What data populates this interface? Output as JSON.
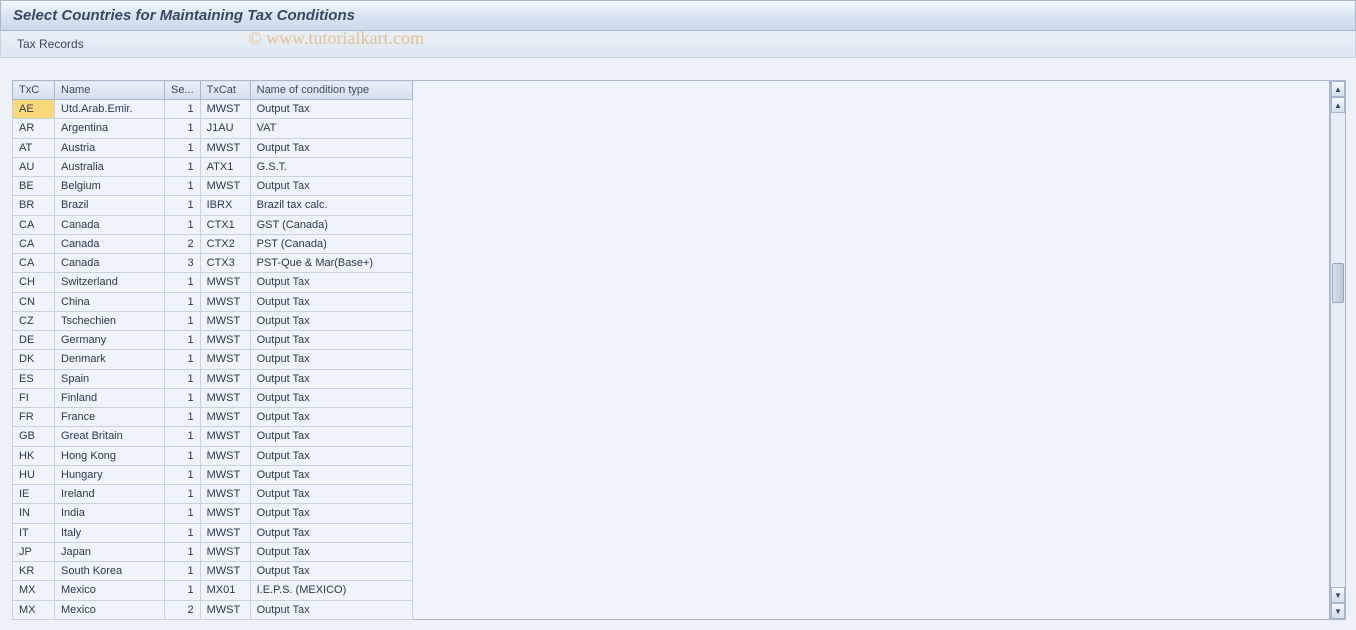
{
  "header": {
    "title": "Select Countries for Maintaining Tax Conditions",
    "subtitle": "Tax Records"
  },
  "watermark": "© www.tutorialkart.com",
  "table": {
    "columns": [
      {
        "key": "txc",
        "label": "TxC"
      },
      {
        "key": "name",
        "label": "Name"
      },
      {
        "key": "se",
        "label": "Se..."
      },
      {
        "key": "txcat",
        "label": "TxCat"
      },
      {
        "key": "condname",
        "label": "Name of condition type"
      }
    ],
    "rows": [
      {
        "txc": "AE",
        "name": "Utd.Arab.Emir.",
        "se": "1",
        "txcat": "MWST",
        "condname": "Output Tax",
        "selected": true
      },
      {
        "txc": "AR",
        "name": "Argentina",
        "se": "1",
        "txcat": "J1AU",
        "condname": "VAT"
      },
      {
        "txc": "AT",
        "name": "Austria",
        "se": "1",
        "txcat": "MWST",
        "condname": "Output Tax"
      },
      {
        "txc": "AU",
        "name": "Australia",
        "se": "1",
        "txcat": "ATX1",
        "condname": "G.S.T."
      },
      {
        "txc": "BE",
        "name": "Belgium",
        "se": "1",
        "txcat": "MWST",
        "condname": "Output Tax"
      },
      {
        "txc": "BR",
        "name": "Brazil",
        "se": "1",
        "txcat": "IBRX",
        "condname": "Brazil tax calc."
      },
      {
        "txc": "CA",
        "name": "Canada",
        "se": "1",
        "txcat": "CTX1",
        "condname": "GST (Canada)"
      },
      {
        "txc": "CA",
        "name": "Canada",
        "se": "2",
        "txcat": "CTX2",
        "condname": "PST (Canada)"
      },
      {
        "txc": "CA",
        "name": "Canada",
        "se": "3",
        "txcat": "CTX3",
        "condname": "PST-Que & Mar(Base+)"
      },
      {
        "txc": "CH",
        "name": "Switzerland",
        "se": "1",
        "txcat": "MWST",
        "condname": "Output Tax"
      },
      {
        "txc": "CN",
        "name": "China",
        "se": "1",
        "txcat": "MWST",
        "condname": "Output Tax"
      },
      {
        "txc": "CZ",
        "name": "Tschechien",
        "se": "1",
        "txcat": "MWST",
        "condname": "Output Tax"
      },
      {
        "txc": "DE",
        "name": "Germany",
        "se": "1",
        "txcat": "MWST",
        "condname": "Output Tax"
      },
      {
        "txc": "DK",
        "name": "Denmark",
        "se": "1",
        "txcat": "MWST",
        "condname": "Output Tax"
      },
      {
        "txc": "ES",
        "name": "Spain",
        "se": "1",
        "txcat": "MWST",
        "condname": "Output Tax"
      },
      {
        "txc": "FI",
        "name": "Finland",
        "se": "1",
        "txcat": "MWST",
        "condname": "Output Tax"
      },
      {
        "txc": "FR",
        "name": "France",
        "se": "1",
        "txcat": "MWST",
        "condname": "Output Tax"
      },
      {
        "txc": "GB",
        "name": "Great Britain",
        "se": "1",
        "txcat": "MWST",
        "condname": "Output Tax"
      },
      {
        "txc": "HK",
        "name": "Hong Kong",
        "se": "1",
        "txcat": "MWST",
        "condname": "Output Tax"
      },
      {
        "txc": "HU",
        "name": "Hungary",
        "se": "1",
        "txcat": "MWST",
        "condname": "Output Tax"
      },
      {
        "txc": "IE",
        "name": "Ireland",
        "se": "1",
        "txcat": "MWST",
        "condname": "Output Tax"
      },
      {
        "txc": "IN",
        "name": "India",
        "se": "1",
        "txcat": "MWST",
        "condname": "Output Tax"
      },
      {
        "txc": "IT",
        "name": "Italy",
        "se": "1",
        "txcat": "MWST",
        "condname": "Output Tax"
      },
      {
        "txc": "JP",
        "name": "Japan",
        "se": "1",
        "txcat": "MWST",
        "condname": "Output Tax"
      },
      {
        "txc": "KR",
        "name": "South Korea",
        "se": "1",
        "txcat": "MWST",
        "condname": "Output Tax"
      },
      {
        "txc": "MX",
        "name": "Mexico",
        "se": "1",
        "txcat": "MX01",
        "condname": "I.E.P.S.  (MEXICO)"
      },
      {
        "txc": "MX",
        "name": "Mexico",
        "se": "2",
        "txcat": "MWST",
        "condname": "Output Tax"
      }
    ]
  }
}
